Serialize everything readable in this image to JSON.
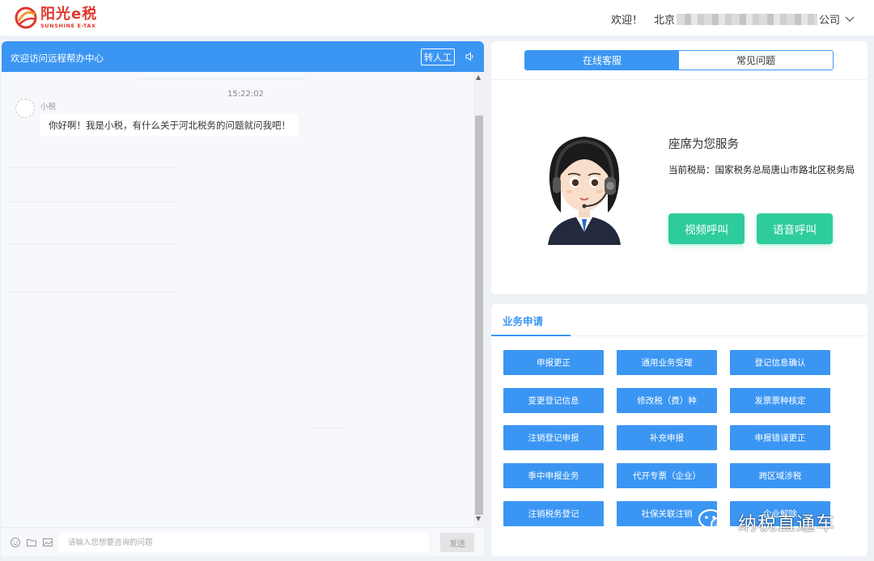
{
  "header": {
    "logo_cn": "阳光e税",
    "logo_en": "SUNSHINE E-TAX",
    "welcome": "欢迎！",
    "company_prefix": "北京",
    "company_suffix": "公司",
    "dropdown_icon": "chevron-down-icon"
  },
  "chat": {
    "title": "欢迎访问远程帮办中心",
    "transfer_label": "转人工",
    "timestamp": "15:22:02",
    "sender": "小税",
    "message": "你好啊！我是小税，有什么关于河北税务的问题就问我吧！",
    "input_placeholder": "请输入您想要咨询的问题",
    "send_label": "发送"
  },
  "service": {
    "tabs": [
      {
        "label": "在线客服",
        "active": true
      },
      {
        "label": "常见问题",
        "active": false
      }
    ],
    "title": "座席为您服务",
    "bureau": "当前税局：国家税务总局唐山市路北区税务局",
    "video_call": "视频呼叫",
    "voice_call": "语音呼叫",
    "call_color": "#2ecc9c"
  },
  "business": {
    "title": "业务申请",
    "buttons": [
      [
        "申报更正",
        "通用业务受理",
        "登记信息确认"
      ],
      [
        "变更登记信息",
        "修改税（费）种",
        "发票票种核定"
      ],
      [
        "注销登记申报",
        "补充申报",
        "申报错误更正"
      ],
      [
        "季中申报业务",
        "代开专票（企业）",
        "跨区域涉税"
      ],
      [
        "注销税务登记",
        "社保关联注销",
        "企业解除"
      ]
    ],
    "accent": "#3b96f3"
  },
  "watermark": {
    "text": "纳税直通车"
  }
}
